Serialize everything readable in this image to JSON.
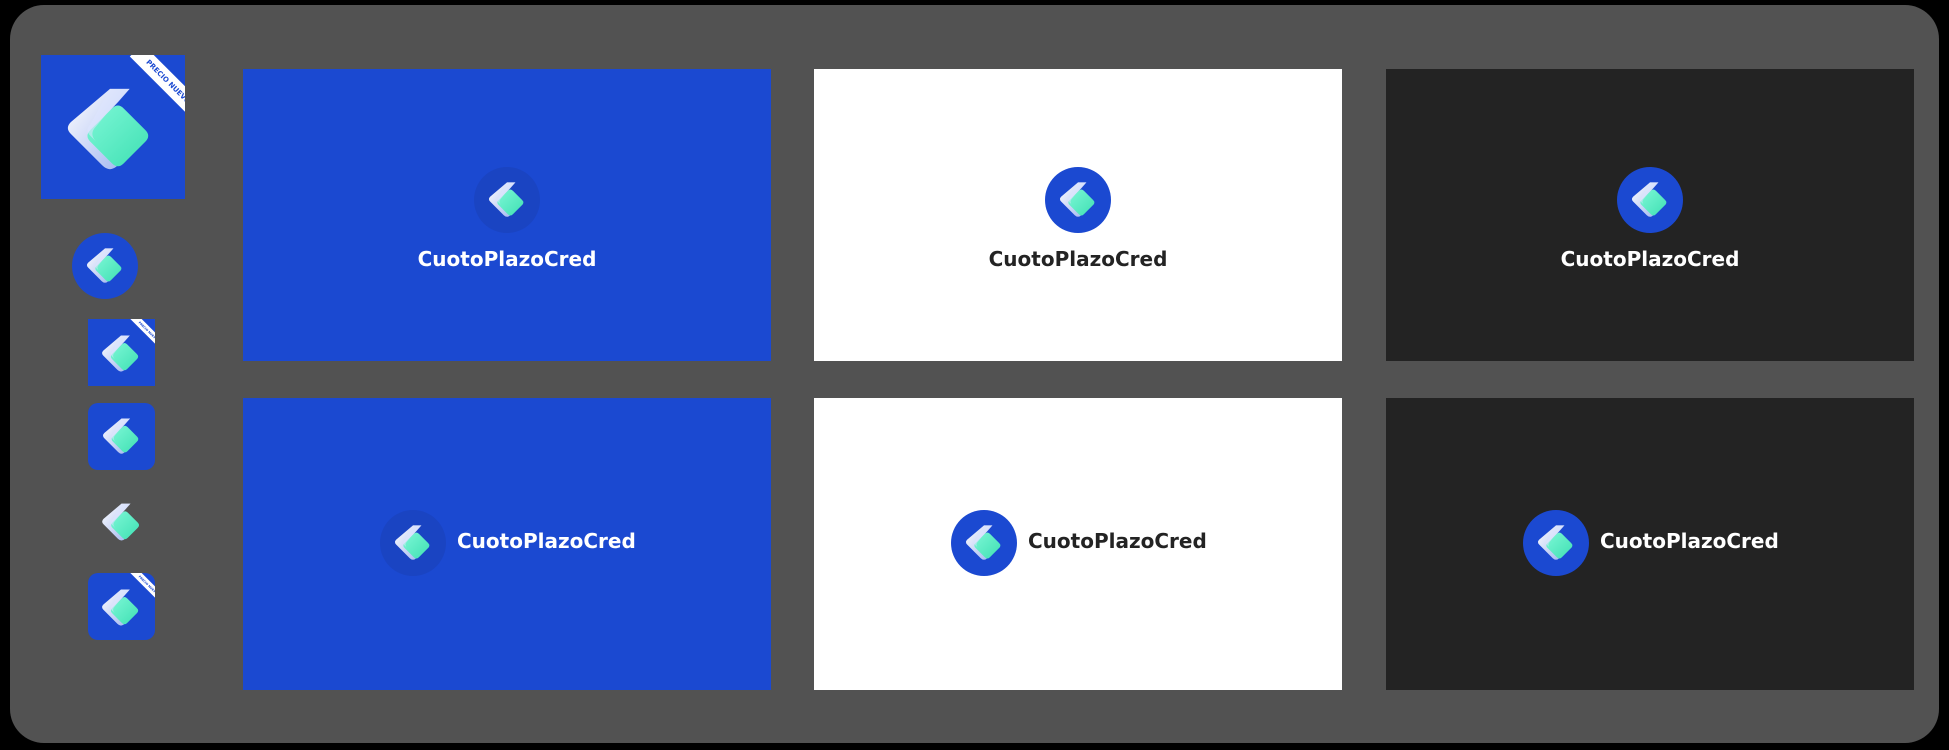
{
  "brand": {
    "name": "CuotoPlazoCred",
    "ribbon_text": "PRECIO NUEVO",
    "colors": {
      "blue": "#1b49d1",
      "mint": "#5ff0c8",
      "white": "#ffffff",
      "dark": "#232323",
      "board": "#525252"
    }
  },
  "icons": {
    "app_icon_large": "app-icon-with-ribbon",
    "circle_icon": "circle-logo",
    "square_ribbon_icon": "square-icon-with-ribbon",
    "rounded_icon": "rounded-square-icon",
    "bare_mark": "logo-mark",
    "rounded_ribbon_icon": "rounded-square-icon-with-ribbon"
  },
  "cards": [
    {
      "theme": "blue",
      "layout": "stacked",
      "wordmark": "CuotoPlazoCred"
    },
    {
      "theme": "white",
      "layout": "stacked",
      "wordmark": "CuotoPlazoCred"
    },
    {
      "theme": "dark",
      "layout": "stacked",
      "wordmark": "CuotoPlazoCred"
    },
    {
      "theme": "blue",
      "layout": "horizontal",
      "wordmark": "CuotoPlazoCred"
    },
    {
      "theme": "white",
      "layout": "horizontal",
      "wordmark": "CuotoPlazoCred"
    },
    {
      "theme": "dark",
      "layout": "horizontal",
      "wordmark": "CuotoPlazoCred"
    }
  ]
}
